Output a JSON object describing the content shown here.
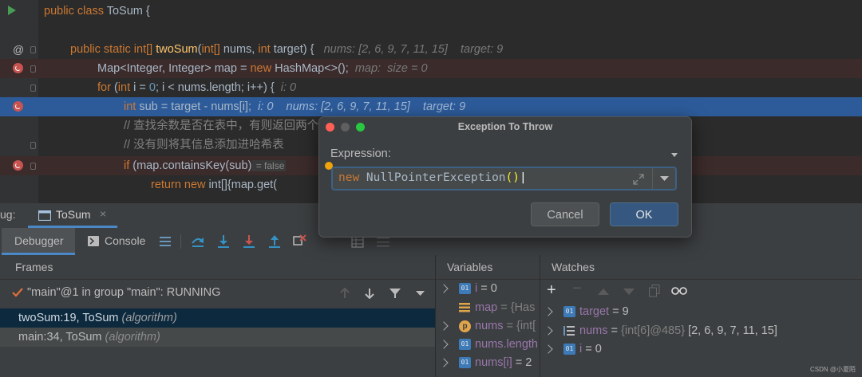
{
  "editor": {
    "line1": {
      "kw": "public class",
      "name": "ToSum",
      "brace": " {"
    },
    "line2": {
      "kw1": "public static",
      "type": "int[]",
      "method": "twoSum",
      "params_a": "(",
      "ptype1": "int[]",
      "pname1": " nums, ",
      "ptype2": "int",
      "pname2": " target) {",
      "hint": "nums: [2, 6, 9, 7, 11, 15]    target: 9"
    },
    "line3": {
      "code_a": "Map<Integer, Integer> map = ",
      "kw": "new",
      "code_b": " HashMap<>();",
      "hint": "map:  size = 0"
    },
    "line4": {
      "kw1": "for",
      "code_a": " (",
      "kw2": "int",
      "code_b": " i = ",
      "num": "0",
      "code_c": "; i < nums.length; i++) {",
      "hint": "i: 0"
    },
    "line5": {
      "kw": "int",
      "code": " sub = target - nums[i];",
      "hint": "i: 0    nums: [2, 6, 9, 7, 11, 15]    target: 9"
    },
    "line6": {
      "comment": "// 查找余数是否在表中，有则返回两个"
    },
    "line7": {
      "comment": "// 没有则将其信息添加进哈希表"
    },
    "line8": {
      "kw": "if",
      "code": " (map.containsKey(sub)",
      "hint": " = false"
    },
    "line9": {
      "kw1": "return",
      "kw2": "new",
      "code_a": " int[]{map.get("
    }
  },
  "debug_header": {
    "label": "ug:",
    "tab_label": "ToSum",
    "close": "×"
  },
  "toolbar": {
    "debugger_tab": "Debugger",
    "console_tab": "Console"
  },
  "frames": {
    "title": "Frames",
    "thread": "\"main\"@1 in group \"main\": RUNNING",
    "rows": [
      {
        "method": "twoSum:19, ToSum ",
        "cls": "(algorithm)"
      },
      {
        "method": "main:34, ToSum ",
        "cls": "(algorithm)"
      }
    ]
  },
  "variables": {
    "title": "Variables",
    "items": [
      {
        "name": "i",
        "value": " = 0"
      },
      {
        "name": "map",
        "value": " = {Has"
      },
      {
        "name": "nums",
        "value": " = {int["
      },
      {
        "name": "nums.length",
        "value": ""
      },
      {
        "name": "nums[i]",
        "value": " = 2"
      }
    ]
  },
  "watches": {
    "title": "Watches",
    "items": [
      {
        "name": "target",
        "value": " = 9"
      },
      {
        "name": "nums",
        "value": " = ",
        "type": "{int[6]@485}",
        "extra": " [2, 6, 9, 7, 11, 15]"
      },
      {
        "name": "i",
        "value": " = 0"
      }
    ]
  },
  "dialog": {
    "title": "Exception To Throw",
    "expression_label": "Expression:",
    "expr_kw": "new",
    "expr_code": " NullPointerException",
    "expr_paren": "()",
    "cancel": "Cancel",
    "ok": "OK",
    "colors": {
      "close": "#ff5f57",
      "minimize": "#5f5f5f",
      "zoom": "#28c840"
    }
  },
  "watermark": "CSDN @小夏陌"
}
